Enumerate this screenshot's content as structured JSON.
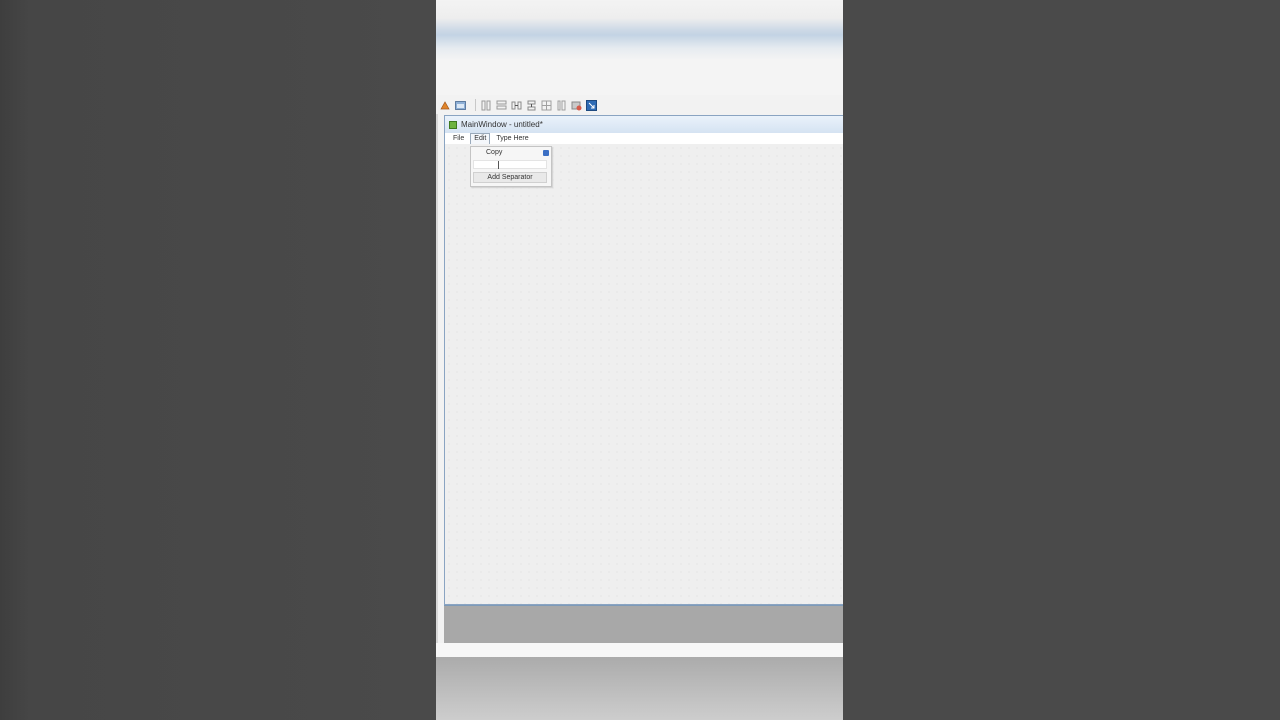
{
  "window": {
    "title": "MainWindow - untitled*"
  },
  "menubar": {
    "items": [
      {
        "label": "File"
      },
      {
        "label": "Edit",
        "active": true
      },
      {
        "label": "Type Here"
      }
    ]
  },
  "edit_menu": {
    "items": [
      {
        "label": "Copy"
      }
    ],
    "edit_field_value": "",
    "add_separator_label": "Add Separator"
  },
  "toolbar": {
    "icons": [
      "edit-signals-icon",
      "edit-widgets-icon",
      "lay-out-horizontally-icon",
      "lay-out-vertically-icon",
      "lay-out-horizontal-splitter-icon",
      "lay-out-vertical-splitter-icon",
      "lay-out-grid-icon",
      "lay-out-form-icon",
      "break-layout-icon",
      "adjust-size-icon"
    ]
  },
  "colors": {
    "titlebar": "#d5e3f2",
    "menu_active_border": "#9aaabb",
    "form_background": "#efefef",
    "pin_icon": "#3b6fc4"
  }
}
